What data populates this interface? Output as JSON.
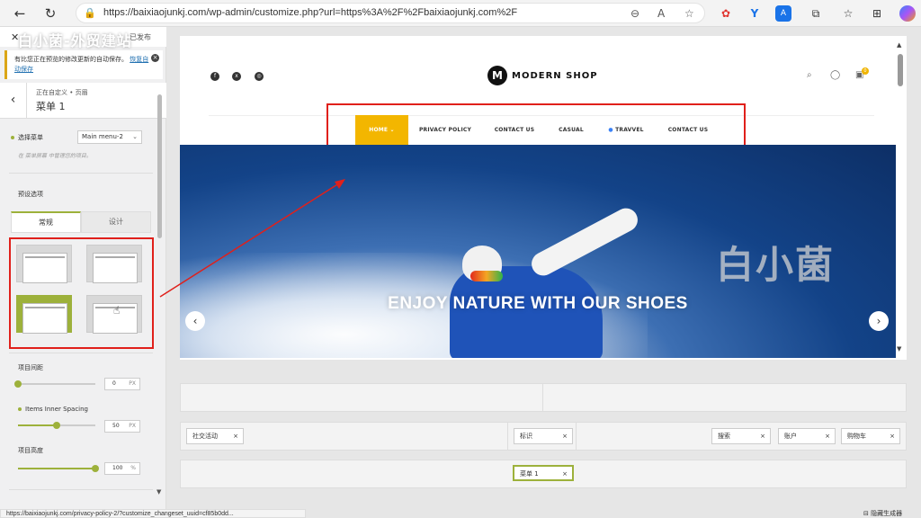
{
  "browser": {
    "url": "https://baixiaojunkj.com/wp-admin/customize.php?url=https%3A%2F%2Fbaixiaojunkj.com%2F",
    "back_icon": "back-arrow-icon",
    "refresh_icon": "refresh-icon"
  },
  "sidebar": {
    "close_label": "✕",
    "publish_label": "已发布",
    "watermark": "白小菌-外贸建站",
    "notice_text": "有比您正在预览的修改更新的自动保存。",
    "notice_link": "恢复自动保存",
    "breadcrumb": "正在自定义 • 页眉",
    "section_title": "菜单 1",
    "select_menu_label": "选择菜单",
    "select_menu_value": "Main menu-2",
    "select_menu_hint": "在 菜单屏幕 中管理您的项目。",
    "preset_label": "预设选项",
    "tab_general": "常规",
    "tab_design": "设计",
    "item_spacing_label": "项目间距",
    "item_spacing_value": "0",
    "item_spacing_unit": "PX",
    "item_spacing_fraction": 0.0,
    "inner_spacing_label": "Items Inner Spacing",
    "inner_spacing_value": "50",
    "inner_spacing_unit": "PX",
    "inner_spacing_fraction": 0.5,
    "item_height_label": "项目高度",
    "item_height_value": "100",
    "item_height_unit": "%",
    "item_height_fraction": 1.0
  },
  "preview": {
    "logo_letter": "M",
    "logo_text": "MODERN SHOP",
    "cart_count": "0",
    "menu": [
      "HOME",
      "PRIVACY POLICY",
      "CONTACT US",
      "CASUAL",
      "TRAVVEL",
      "CONTACT US"
    ],
    "hero_title": "ENJOY NATURE WITH OUR SHOES",
    "hero_watermark": "白小菌",
    "prev_label": "‹",
    "next_label": "›"
  },
  "builder": {
    "row2": {
      "left_chip": "社交活动",
      "center_chip": "标识",
      "right_chips": [
        "搜索",
        "账户",
        "购物车"
      ]
    },
    "row3": {
      "center_chip": "菜单 1"
    },
    "remove_label": "×"
  },
  "status_bar": {
    "link": "https://baixiaojunkj.com/privacy-policy-2/?customize_changeset_uuid=cf85b0dd...",
    "hide_controls": "隐藏生成器"
  },
  "colors": {
    "accent_green": "#9db13b",
    "highlight_red": "#e0201b",
    "home_yellow": "#f3b600"
  }
}
